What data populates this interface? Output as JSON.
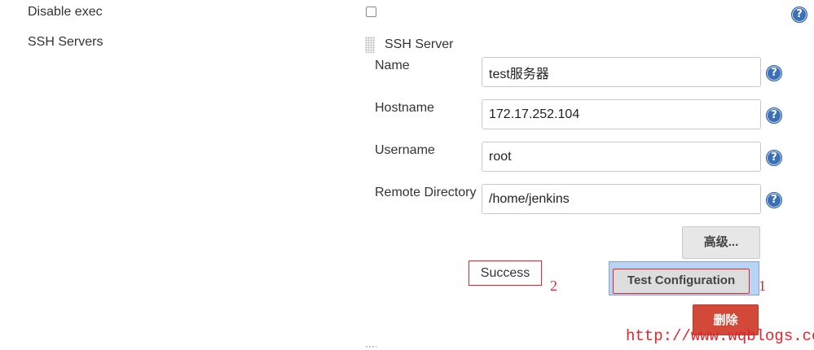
{
  "disable_exec": {
    "label": "Disable exec",
    "checked": false
  },
  "ssh_servers": {
    "label": "SSH Servers",
    "section_title": "SSH Server",
    "fields": {
      "name": {
        "label": "Name",
        "value": "test服务器"
      },
      "hostname": {
        "label": "Hostname",
        "value": "172.17.252.104"
      },
      "username": {
        "label": "Username",
        "value": "root"
      },
      "remote_directory": {
        "label": "Remote Directory",
        "value": "/home/jenkins"
      }
    },
    "advanced_button": "高级...",
    "test_button": "Test Configuration",
    "status_text": "Success",
    "delete_button": "删除"
  },
  "annotations": {
    "marker_1": "1",
    "marker_2": "2"
  },
  "help_glyph": "?",
  "watermark": "http://www.wqblogs.com",
  "colors": {
    "help": "#3b6fb6",
    "delete": "#d24939",
    "annotation": "#e0262f",
    "highlight": "#b9d3f2"
  },
  "icons": {
    "help": "question-circle-icon",
    "drag": "drag-handle-icon"
  }
}
